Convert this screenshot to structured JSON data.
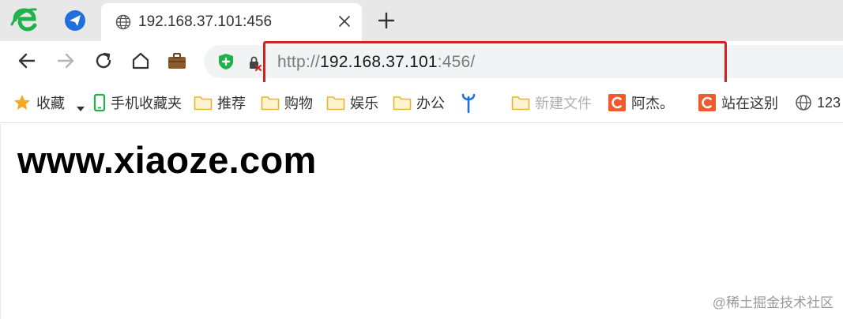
{
  "browser": {
    "app_icon": "ie-e-logo-icon",
    "pinned_tab_icon": "paper-plane-icon",
    "active_tab": {
      "title": "192.168.37.101:456",
      "icon": "globe-icon"
    }
  },
  "navbar": {
    "url_protocol": "http://",
    "url_host": "192.168.37.101",
    "url_rest": ":456/"
  },
  "bookmarks": {
    "favorites_label": "收藏",
    "mobile_label": "手机收藏夹",
    "folders": [
      "推荐",
      "购物",
      "娱乐",
      "办公"
    ],
    "new_folder_label": "新建文件",
    "site1_label": "阿杰。",
    "site2_label": "站在这别",
    "site3_label": "123"
  },
  "page": {
    "heading": "www.xiaoze.com"
  },
  "watermark": "@稀土掘金技术社区",
  "colors": {
    "highlight": "#d32222",
    "logo_green": "#1fb24a",
    "pinned_blue": "#1f6fdc",
    "folder_yellow": "#f2c94c",
    "site_orange": "#f15a2b"
  }
}
